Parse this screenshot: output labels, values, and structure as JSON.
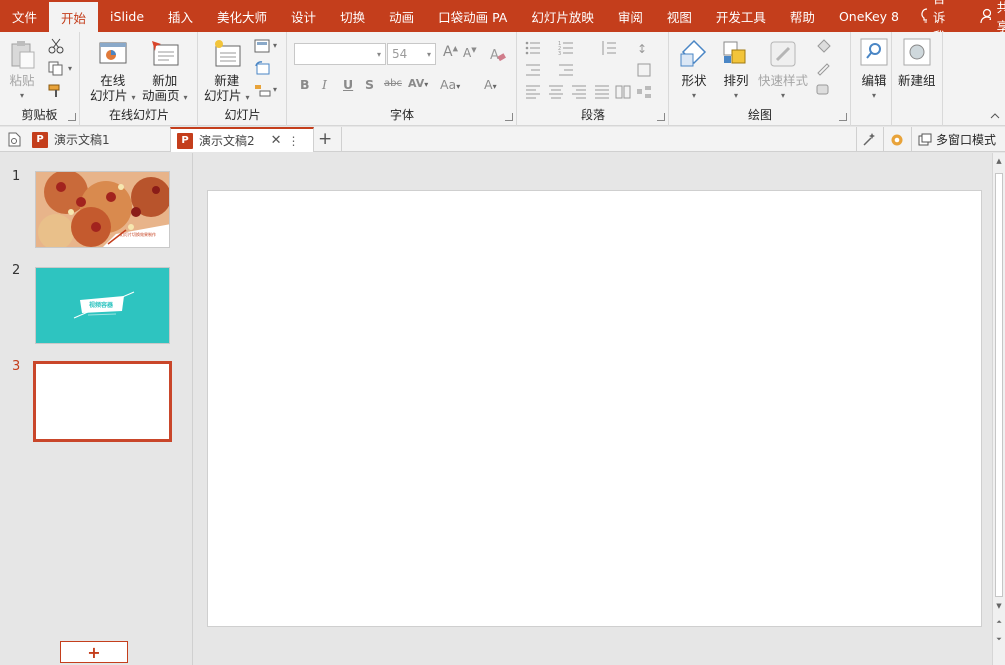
{
  "menu": {
    "items": [
      "文件",
      "开始",
      "iSlide",
      "插入",
      "美化大师",
      "设计",
      "切换",
      "动画",
      "口袋动画 PA",
      "幻灯片放映",
      "审阅",
      "视图",
      "开发工具",
      "帮助",
      "OneKey 8"
    ],
    "active_index": 1,
    "tell_me": "告诉我",
    "share": "共享"
  },
  "ribbon": {
    "clipboard": {
      "paste": "粘贴",
      "label": "剪贴板"
    },
    "online": {
      "online_slides": "在线",
      "online_slides_2": "幻灯片",
      "new_anim": "新加",
      "new_anim_2": "动画页",
      "label": "在线幻灯片"
    },
    "slides": {
      "new_slide": "新建",
      "new_slide_2": "幻灯片",
      "label": "幻灯片"
    },
    "font": {
      "font_name": "",
      "font_size": "54",
      "label": "字体"
    },
    "paragraph": {
      "label": "段落"
    },
    "drawing": {
      "shapes": "形状",
      "arrange": "排列",
      "quick_styles": "快速样式",
      "label": "绘图"
    },
    "editing": {
      "edit": "编辑"
    },
    "new_group": {
      "label": "新建组"
    }
  },
  "tabs": {
    "doc1": "演示文稿1",
    "doc2": "演示文稿2",
    "multi_window": "多窗口模式"
  },
  "thumbnails": [
    {
      "number": "1",
      "caption": "幻灯片切换效果制作"
    },
    {
      "number": "2",
      "caption": "视频容器"
    },
    {
      "number": "3",
      "caption": ""
    }
  ],
  "colors": {
    "accent": "#c43e1c",
    "teal": "#2ec4c0"
  }
}
